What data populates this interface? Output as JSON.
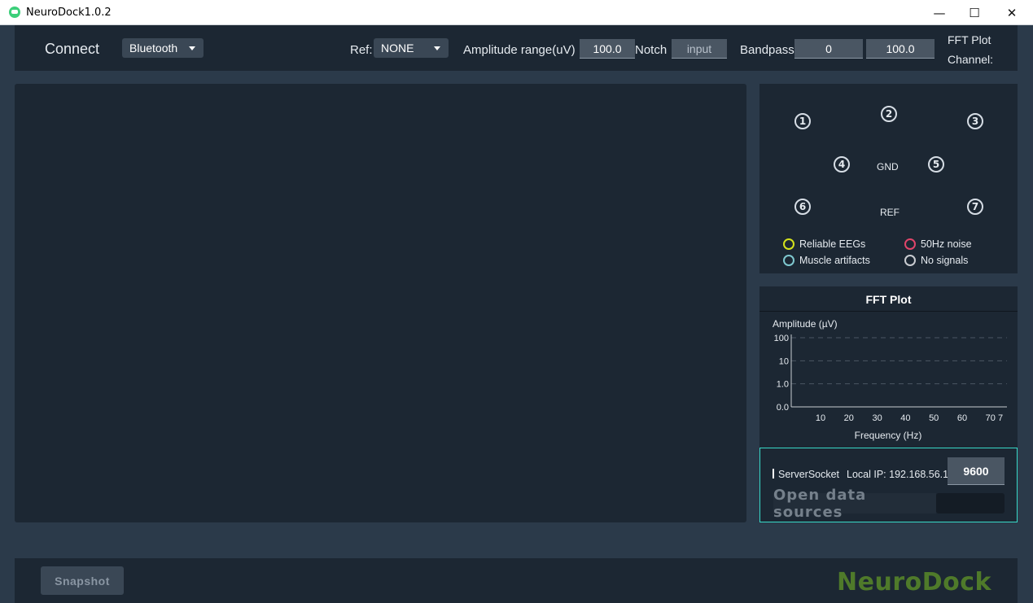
{
  "window": {
    "title": "NeuroDock1.0.2",
    "minimize": "—",
    "maximize": "☐",
    "close": "✕"
  },
  "toolbar": {
    "connect_label": "Connect",
    "connection_type": "Bluetooth",
    "ref_label": "Ref:",
    "ref_value": "NONE",
    "amplitude_label": "Amplitude range(uV)",
    "amplitude_value": "100.0",
    "notch_label": "Notch",
    "notch_placeholder": "input",
    "bandpass_label": "Bandpass",
    "bandpass_low": "0",
    "bandpass_high": "100.0",
    "fft_plot_label": "FFT Plot",
    "channel_label": "Channel:"
  },
  "electrodes": {
    "e1": "1",
    "e2": "2",
    "e3": "3",
    "e4": "4",
    "e5": "5",
    "e6": "6",
    "e7": "7",
    "gnd": "GND",
    "ref": "REF"
  },
  "legend": {
    "reliable": {
      "label": "Reliable EEGs",
      "color": "#d4e21c"
    },
    "noise": {
      "label": "50Hz noise",
      "color": "#e0456a"
    },
    "muscle": {
      "label": "Muscle artifacts",
      "color": "#7fc8cf"
    },
    "nosignal": {
      "label": "No signals",
      "color": "#c9ccd1"
    }
  },
  "fft": {
    "title": "FFT Plot",
    "chart_data": {
      "type": "line",
      "ylabel": "Amplitude (µV)",
      "xlabel": "Frequency (Hz)",
      "y_scale": "log",
      "y_ticks": [
        "100",
        "10",
        "1.0",
        "0.0"
      ],
      "x_ticks": [
        "10",
        "20",
        "30",
        "40",
        "50",
        "60",
        "70",
        "7"
      ],
      "series": [],
      "grid": true
    }
  },
  "socket": {
    "label": "ServerSocket",
    "local_ip_label": "Local IP: 192.168.56.1",
    "port": "9600",
    "open_button": "Open data sources"
  },
  "footer": {
    "snapshot_label": "Snapshot",
    "brand": "NeuroDock"
  }
}
